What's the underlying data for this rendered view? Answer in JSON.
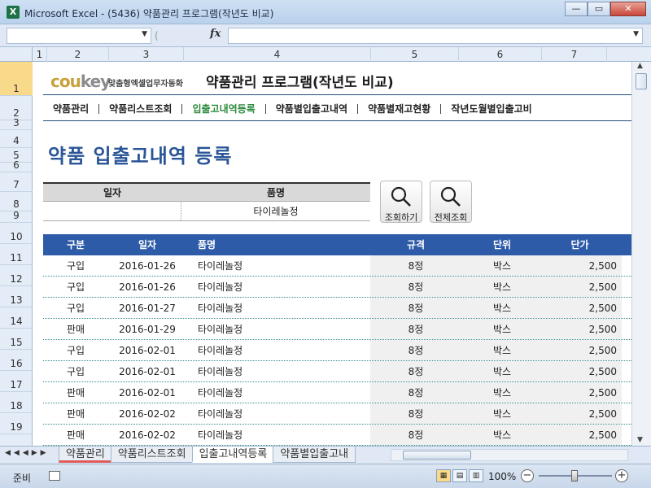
{
  "window": {
    "title": "Microsoft Excel - (5436) 약품관리 프로그램(작년도 비교)",
    "minimize": "—",
    "maximize": "▭",
    "close": "✕"
  },
  "formula_bar": {
    "fx_label": "fx"
  },
  "columns": [
    "1",
    "2",
    "3",
    "4",
    "5",
    "6",
    "7"
  ],
  "rows": [
    "1",
    "2",
    "3",
    "4",
    "5",
    "6",
    "7",
    "8",
    "9",
    "10",
    "11",
    "12",
    "13",
    "14",
    "15",
    "16",
    "17",
    "18",
    "19"
  ],
  "header": {
    "logo_main": "cou",
    "logo_key": "key",
    "logo_sub": "맞춤형엑셀업무자동화",
    "program_title": "약품관리 프로그램(작년도 비교)"
  },
  "nav": [
    {
      "label": "약품관리",
      "active": false
    },
    {
      "label": "약품리스트조회",
      "active": false
    },
    {
      "label": "입출고내역등록",
      "active": true
    },
    {
      "label": "약품별입출고내역",
      "active": false
    },
    {
      "label": "약품별재고현황",
      "active": false
    },
    {
      "label": "작년도월별입출고비",
      "active": false
    }
  ],
  "page_heading": "약품 입출고내역 등록",
  "search": {
    "date_label": "일자",
    "item_label": "품명",
    "date_value": "",
    "item_value": "타이레놀정",
    "query_button": "조회하기",
    "all_button": "전체조회"
  },
  "table": {
    "headers": {
      "type": "구분",
      "date": "일자",
      "name": "품명",
      "spec": "규격",
      "unit": "단위",
      "price": "단가"
    },
    "rows": [
      {
        "type": "구입",
        "date": "2016-01-26",
        "name": "타이레놀정",
        "spec": "8정",
        "unit": "박스",
        "price": "2,500"
      },
      {
        "type": "구입",
        "date": "2016-01-26",
        "name": "타이레놀정",
        "spec": "8정",
        "unit": "박스",
        "price": "2,500"
      },
      {
        "type": "구입",
        "date": "2016-01-27",
        "name": "타이레놀정",
        "spec": "8정",
        "unit": "박스",
        "price": "2,500"
      },
      {
        "type": "판매",
        "date": "2016-01-29",
        "name": "타이레놀정",
        "spec": "8정",
        "unit": "박스",
        "price": "2,500"
      },
      {
        "type": "구입",
        "date": "2016-02-01",
        "name": "타이레놀정",
        "spec": "8정",
        "unit": "박스",
        "price": "2,500"
      },
      {
        "type": "구입",
        "date": "2016-02-01",
        "name": "타이레놀정",
        "spec": "8정",
        "unit": "박스",
        "price": "2,500"
      },
      {
        "type": "판매",
        "date": "2016-02-01",
        "name": "타이레놀정",
        "spec": "8정",
        "unit": "박스",
        "price": "2,500"
      },
      {
        "type": "판매",
        "date": "2016-02-02",
        "name": "타이레놀정",
        "spec": "8정",
        "unit": "박스",
        "price": "2,500"
      },
      {
        "type": "판매",
        "date": "2016-02-02",
        "name": "타이레놀정",
        "spec": "8정",
        "unit": "박스",
        "price": "2,500"
      }
    ]
  },
  "sheet_tabs": [
    {
      "label": "약품관리",
      "active": false
    },
    {
      "label": "약품리스트조회",
      "active": false
    },
    {
      "label": "입출고내역등록",
      "active": true
    },
    {
      "label": "약품별입출고내",
      "active": false
    }
  ],
  "status": {
    "ready": "준비",
    "zoom": "100%"
  }
}
